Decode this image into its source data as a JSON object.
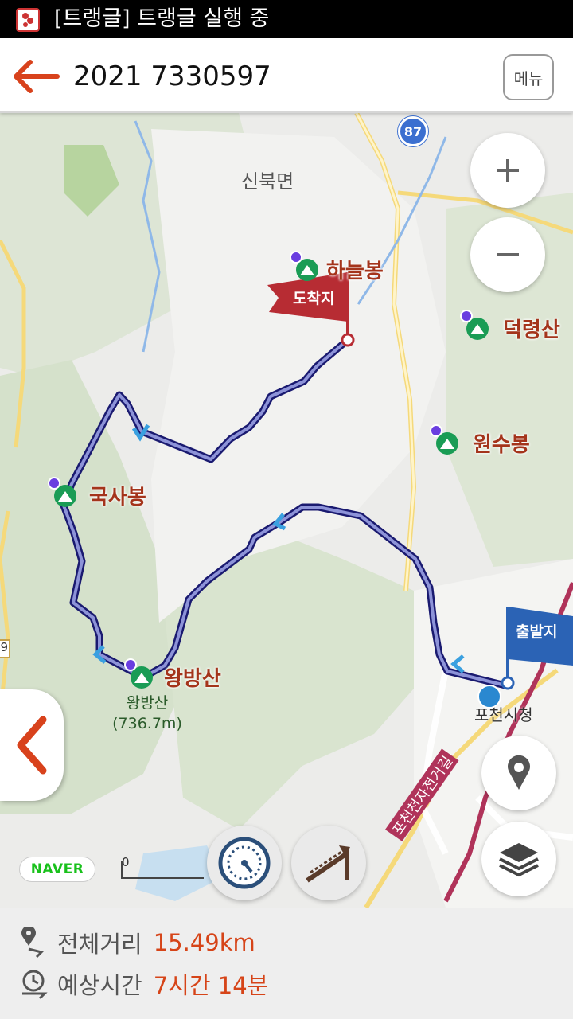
{
  "status_bar": {
    "title": "[트랭글] 트랭글 실행 중",
    "app_icon": "trangle-app-icon"
  },
  "header": {
    "title": "2021 7330597",
    "menu_label": "메뉴",
    "back_icon": "back-arrow-icon"
  },
  "map": {
    "region_label": "신북면",
    "route_number": "87",
    "places": {
      "haneulbong": "하늘봉",
      "deokryeongsan": "덕령산",
      "wonsubong": "원수봉",
      "guksabong": "국사봉",
      "wangbangsan": "왕방산"
    },
    "peak_caption": {
      "name": "왕방산",
      "height": "(736.7m)"
    },
    "flags": {
      "arrival": "도착지",
      "departure": "출발지"
    },
    "city_hall": "포천시청",
    "road_name": "포천천자전거길",
    "left_road_badge": "9",
    "naver_logo": "NAVER",
    "scale_label": "0",
    "colors": {
      "route": "#2b3fc0",
      "arrival_flag": "#b72c33",
      "departure_flag": "#2b63b5",
      "place_label": "#a4341b"
    }
  },
  "controls": {
    "zoom_in_icon": "plus-icon",
    "zoom_out_icon": "minus-icon",
    "location_icon": "location-pin-icon",
    "layers_icon": "layers-icon",
    "speed_icon": "speedometer-icon",
    "elevation_icon": "elevation-slope-icon",
    "side_tab_icon": "chevron-left-icon"
  },
  "summary": {
    "distance_label": "전체거리",
    "distance_value": "15.49km",
    "time_label": "예상시간",
    "time_value": "7시간 14분",
    "accent": "#d64418"
  }
}
